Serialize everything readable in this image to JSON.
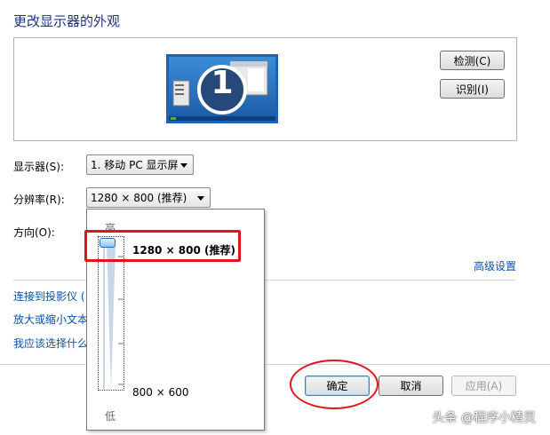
{
  "dialog": {
    "title": "更改显示器的外观"
  },
  "preview": {
    "monitor_number": "1",
    "detect_label": "检测(C)",
    "identify_label": "识别(I)"
  },
  "display": {
    "label": "显示器(S):",
    "value": "1. 移动 PC 显示屏"
  },
  "resolution": {
    "label": "分辨率(R):",
    "value": "1280 × 800 (推荐)",
    "slider": {
      "high_label": "高",
      "low_label": "低",
      "top_option": "1280 × 800 (推荐)",
      "bottom_option": "800 × 600",
      "level": 1.0
    }
  },
  "orientation": {
    "label": "方向(O):"
  },
  "advanced_link": "高级设置",
  "links": {
    "projector": "连接到投影仪 (",
    "text_size": "放大或缩小文本",
    "which_settings": "我应该选择什么"
  },
  "footer": {
    "ok_label": "确定",
    "cancel_label": "取消",
    "apply_label": "应用(A)"
  },
  "watermark": "头条 @程序小精灵",
  "colors": {
    "annotation": "#e0141d",
    "link": "#0a52a8",
    "title": "#1e3287"
  }
}
